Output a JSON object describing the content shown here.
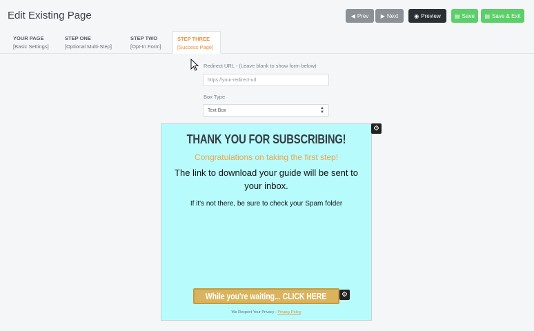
{
  "header": {
    "title": "Edit Existing Page",
    "buttons": {
      "prev": "Prev",
      "next": "Next",
      "preview": "Preview",
      "save": "Save",
      "save_exit": "Save & Exit"
    }
  },
  "tabs": [
    {
      "label": "YOUR PAGE",
      "sub": "[Basic Settings]"
    },
    {
      "label": "STEP ONE",
      "sub": "[Optional Multi-Step]"
    },
    {
      "label": "STEP TWO",
      "sub": "[Opt-In Form]"
    },
    {
      "label": "STEP THREE",
      "sub": "[Success Page]"
    }
  ],
  "active_tab": "STEP THREE",
  "form": {
    "redirect_label": "Redirect URL - (Leave blank to show form below)",
    "redirect_placeholder": "https://your-redirect-url",
    "box_type_label": "Box Type",
    "box_type_value": "Text Box"
  },
  "preview": {
    "title": "THANK YOU FOR SUBSCRIBING!",
    "subtitle": "Congratulations on taking the first step!",
    "body": "The link to download your guide will be sent to your inbox.",
    "note": "If it's not there, be sure to check your Spam folder",
    "cta": "While you're waiting... CLICK HERE",
    "privacy_text": "We Respect Your Privacy -",
    "privacy_link": "Privacy Policy",
    "background_color": "#b8fbfd",
    "cta_color": "#d9b35e"
  },
  "colors": {
    "accent_orange": "#e5903c",
    "green_button": "#5ccf6a",
    "gray_button": "#8c9197",
    "dark_button": "#2b2f33"
  }
}
